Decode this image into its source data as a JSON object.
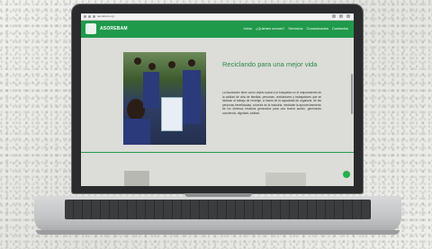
{
  "browser": {
    "url": "asorebam.org"
  },
  "site": {
    "brand": "ASOREBAM",
    "menu": [
      "Inicio",
      "¿Quiénes somos?",
      "Servicios",
      "Comunicados",
      "Contactos"
    ]
  },
  "hero": {
    "title": "Reciclando para una mejor vida",
    "text": "La Asociación tiene como objeto social a la búsqueda en el mejoramiento de la calidad de vida de familias, personas, recicladores y trabajadores que se dedican al trabajo de reciclaje, a través de la capacidad de organizar, de las personas beneficiadas, a través de la industria, mediante la aprovechamiento de los diversos residuos generados para una buena acción, generando conciencia, dignidad, calidad."
  },
  "colors": {
    "brand_green": "#1f9a4a",
    "title_green": "#2a8a44"
  }
}
